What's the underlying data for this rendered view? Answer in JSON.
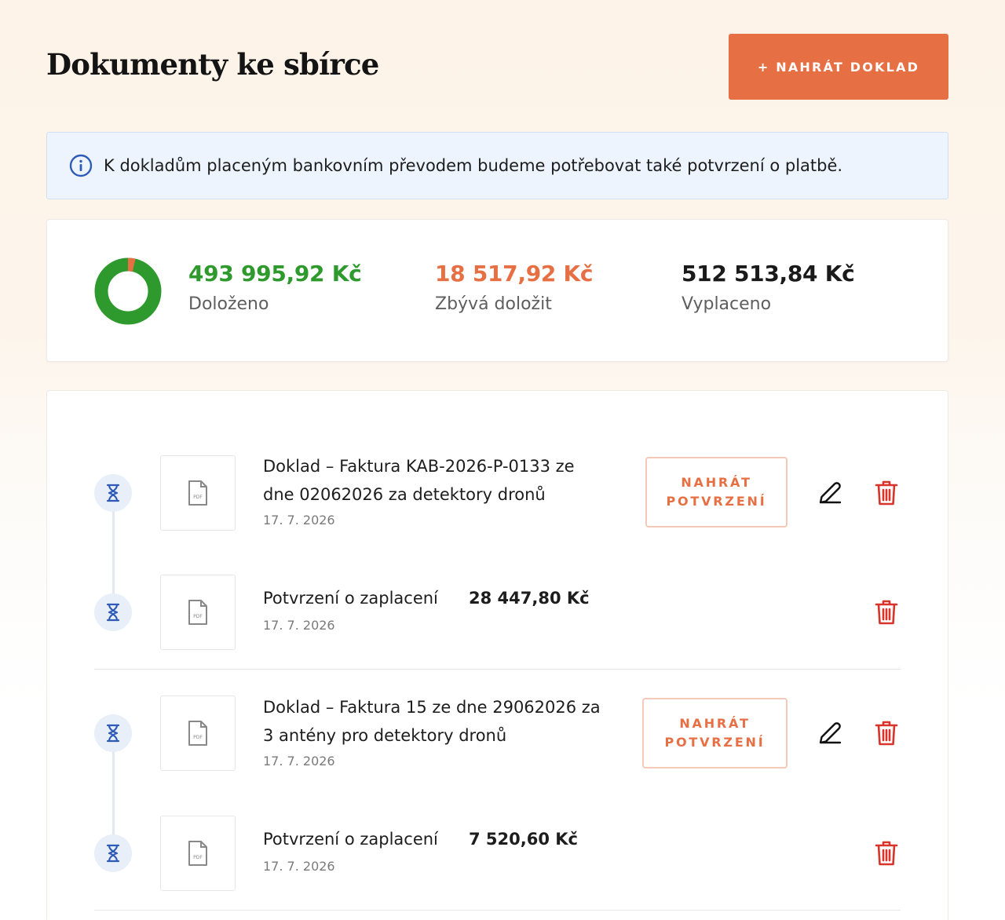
{
  "header": {
    "title": "Dokumenty ke sbírce",
    "upload_label": "+ NAHRÁT DOKLAD"
  },
  "info": {
    "icon": "info-circle-icon",
    "text": "K dokladům placeným bankovním převodem budeme potřebovat také potvrzení o platbě."
  },
  "stats": {
    "chart_data": {
      "type": "pie",
      "categories": [
        "Doloženo",
        "Zbývá doložit"
      ],
      "values": [
        493995.92,
        18517.92
      ]
    },
    "documented": {
      "value": "493 995,92 Kč",
      "label": "Doloženo",
      "color": "#2e9a2e"
    },
    "remaining": {
      "value": "18 517,92 Kč",
      "label": "Zbývá doložit",
      "color": "#e76f44"
    },
    "paid": {
      "value": "512 513,84 Kč",
      "label": "Vyplaceno",
      "color": "#1a1a1a"
    }
  },
  "documents": [
    {
      "title_line1": "Doklad – Faktura KAB-2026-P-0133 ze",
      "title_line2": "dne 02062026 za detektory dronů",
      "date": "17. 7. 2026",
      "confirm_line1": "NAHRÁT",
      "confirm_line2": "POTVRZENÍ",
      "payment": {
        "label": "Potvrzení o zaplacení",
        "amount": "28 447,80 Kč",
        "date": "17. 7. 2026"
      }
    },
    {
      "title_line1": "Doklad – Faktura 15 ze dne 29062026 za",
      "title_line2": "3 antény pro detektory dronů",
      "date": "17. 7. 2026",
      "confirm_line1": "NAHRÁT",
      "confirm_line2": "POTVRZENÍ",
      "payment": {
        "label": "Potvrzení o zaplacení",
        "amount": "7 520,60 Kč",
        "date": "17. 7. 2026"
      }
    }
  ],
  "icons": {
    "status": "hourglass-icon",
    "file": "pdf-file-icon",
    "edit": "pencil-icon",
    "delete": "trash-icon",
    "pdf_text": "PDF"
  },
  "colors": {
    "accent": "#e76f44",
    "status_blue": "#2e5bb8",
    "delete_red": "#d9342b",
    "green": "#2e9a2e"
  }
}
